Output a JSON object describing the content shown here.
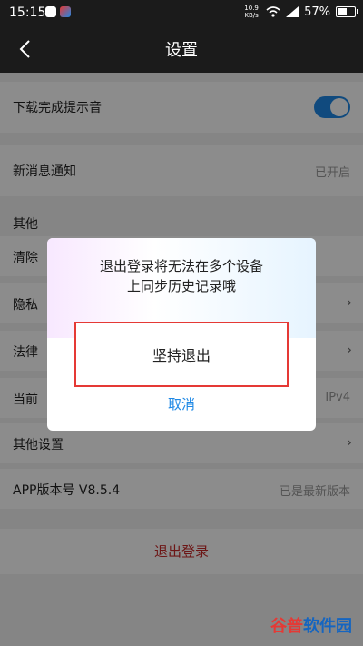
{
  "status_bar": {
    "time": "15:15",
    "network": "10.9 KB/s",
    "battery_text": "57%",
    "battery_fraction": 0.57
  },
  "header": {
    "title": "设置"
  },
  "settings": {
    "download_sound": {
      "label": "下载完成提示音",
      "toggle_on": true
    },
    "new_message": {
      "label": "新消息通知",
      "value": "已开启"
    },
    "section_other": "其他",
    "rows_partial": [
      {
        "label": "清除"
      },
      {
        "label": "隐私"
      },
      {
        "label": "法律"
      },
      {
        "label": "当前",
        "value": "IPv4"
      }
    ],
    "other_settings": {
      "label": "其他设置"
    },
    "app_version": {
      "label": "APP版本号 V8.5.4",
      "value": "已是最新版本"
    }
  },
  "logout": {
    "label": "退出登录"
  },
  "dialog": {
    "message_line1": "退出登录将无法在多个设备",
    "message_line2": "上同步历史记录哦",
    "confirm_label": "坚持退出",
    "cancel_label": "取消"
  },
  "watermark": {
    "part_a": "谷普",
    "part_b": "软件园"
  },
  "colors": {
    "accent": "#1e88e5",
    "danger": "#c62828",
    "highlight_box": "#e53935"
  }
}
